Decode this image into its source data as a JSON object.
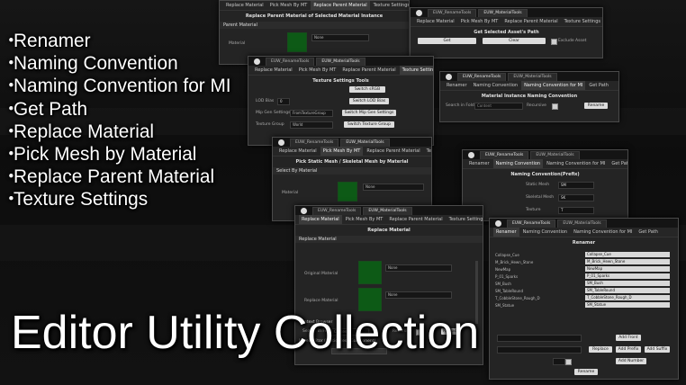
{
  "title": "Editor Utility Collection",
  "features": [
    "Renamer",
    "Naming Convention",
    "Naming Convention for MI",
    "Get Path",
    "Replace Material",
    "Pick Mesh by Material",
    "Replace Parent Material",
    "Texture Settings"
  ],
  "bullet": "・",
  "tool_tabs": {
    "rename": "EUW_RenameTools",
    "material": "EUW_MaterialTools"
  },
  "tabs": {
    "renamer": "Renamer",
    "naming_convention": "Naming Convention",
    "naming_mi": "Naming Convention for MI",
    "get_path": "Get Path",
    "replace_material": "Replace Material",
    "pick_mesh": "Pick Mesh By MT",
    "replace_parent": "Replace Parent Material",
    "texture_settings": "Texture Settings"
  },
  "win_replace_parent": {
    "heading": "Replace Parent Material of Selected Material Instance",
    "section": "Parent Material",
    "label": "Material",
    "dropdown": "None"
  },
  "win_get_path": {
    "heading": "Get Selected Asset's Path",
    "get_button": "Get",
    "clear_button": "Clear",
    "exclude_label": "Exclude Asset"
  },
  "win_texture": {
    "heading": "Texture Settings Tools",
    "switch_srgb": "Switch sRGB",
    "lod_bias_label": "LOD Bias",
    "lod_bias_value": "0",
    "switch_lod": "Switch LOD Bias",
    "mip_label": "Mip Gen Settings",
    "mip_value": "FromTextureGroup",
    "switch_mip": "Switch Mip Gen Settings",
    "group_label": "Texture Group",
    "group_value": "World",
    "switch_group": "Switch Texture Group"
  },
  "win_naming_mi": {
    "heading": "Material Instance Naming Convention",
    "search_label": "Search in Folder",
    "search_placeholder": "Content",
    "recursive_label": "Recursive",
    "rename_button": "Rename"
  },
  "win_pick_mesh": {
    "heading": "Pick Static Mesh / Skeletal Mesh by Material",
    "section": "Select By Material",
    "label": "Material",
    "dropdown": "None"
  },
  "win_naming": {
    "heading": "Naming Convention(Prefix)",
    "rows": [
      {
        "label": "Static Mesh",
        "value": "SM"
      },
      {
        "label": "Skeletal Mesh",
        "value": "SK"
      },
      {
        "label": "Texture",
        "value": "T"
      }
    ]
  },
  "win_replace": {
    "heading": "Replace Material",
    "section": "Replace Material",
    "original_label": "Original Material",
    "replace_label": "Replace Material",
    "dropdown": "None",
    "context_label": "Context Browser",
    "search_label": "Search in Folder",
    "search_placeholder": "Content",
    "recursive_label": "Recursive",
    "replace_button": "Replace",
    "level_label": "Level Editor (Static Mesh Component)"
  },
  "win_renamer": {
    "heading": "Renamer",
    "rows": [
      {
        "label": "Collapse_Cue",
        "value": "Collapse_Cue"
      },
      {
        "label": "M_Brick_Hewn_Stone",
        "value": "M_Brick_Hewn_Stone"
      },
      {
        "label": "NewMap",
        "value": "NewMap"
      },
      {
        "label": "P_01_Sparks",
        "value": "P_01_Sparks"
      },
      {
        "label": "SM_Bush",
        "value": "SM_Bush"
      },
      {
        "label": "SM_TableRound",
        "value": "SM_TableRound"
      },
      {
        "label": "T_CobbleStone_Rough_D",
        "value": "T_CobbleStone_Rough_D"
      },
      {
        "label": "SM_Statue",
        "value": "SM_Statue"
      }
    ],
    "add_front": "Add Front",
    "replace": "Replace",
    "add_prefix": "Add Prefix",
    "add_suffix": "Add Suffix",
    "add_number": "Add Number",
    "rename": "Rename"
  }
}
